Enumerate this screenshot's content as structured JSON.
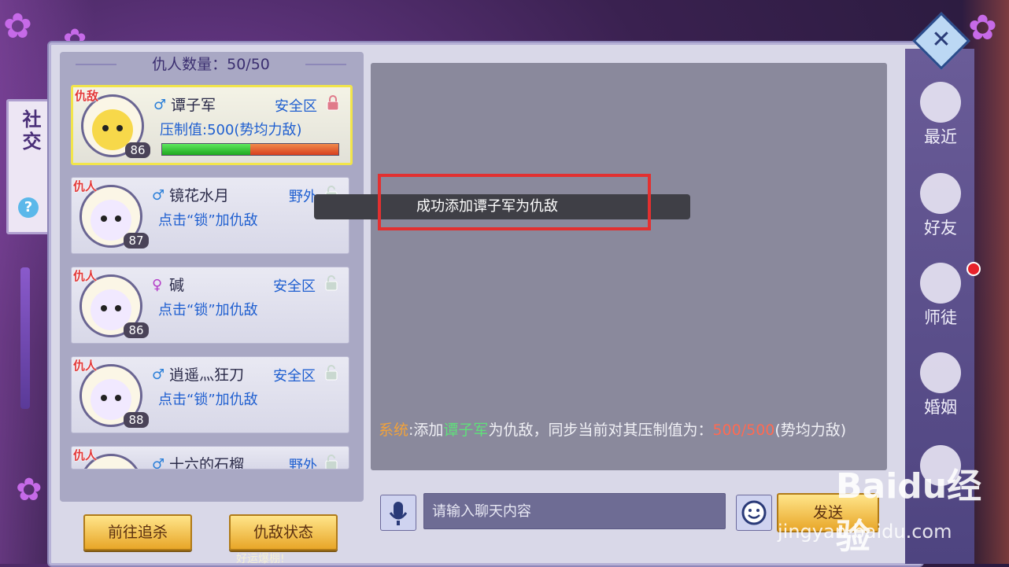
{
  "header": {
    "count_label": "仇人数量：50/50"
  },
  "sidebar_left": {
    "title": "社交",
    "help": "?"
  },
  "enemies": [
    {
      "tag": "仇敌",
      "name": "谭子军",
      "gender": "♂",
      "gender_color": "#2b7fd8",
      "zone": "安全区",
      "line": "压制值:500(势均力敌)",
      "level": "86",
      "has_bar": true,
      "selected": true
    },
    {
      "tag": "仇人",
      "name": "镜花水月",
      "gender": "♂",
      "gender_color": "#2b7fd8",
      "zone": "野外",
      "line": "点击“锁”加仇敌",
      "level": "87",
      "has_bar": false,
      "selected": false
    },
    {
      "tag": "仇人",
      "name": "碱",
      "gender": "♀",
      "gender_color": "#b43ec8",
      "zone": "安全区",
      "line": "点击“锁”加仇敌",
      "level": "86",
      "has_bar": false,
      "selected": false
    },
    {
      "tag": "仇人",
      "name": "逍遥灬狂刀",
      "gender": "♂",
      "gender_color": "#2b7fd8",
      "zone": "安全区",
      "line": "点击“锁”加仇敌",
      "level": "88",
      "has_bar": false,
      "selected": false
    },
    {
      "tag": "仇人",
      "name": "十六的石榴",
      "gender": "♂",
      "gender_color": "#2b7fd8",
      "zone": "野外",
      "line": "",
      "level": "",
      "has_bar": false,
      "selected": false
    }
  ],
  "buttons": {
    "chase": "前往追杀",
    "status": "仇敌状态"
  },
  "toast": "成功添加谭子军为仇敌",
  "system_message": {
    "prefix": "系统",
    "part1": ":添加",
    "name": "谭子军",
    "part2": "为仇敌，同步当前对其压制值为：",
    "value": "500/500",
    "part3": "(势均力敌)"
  },
  "chat_input": {
    "placeholder": "请输入聊天内容",
    "send": "发送"
  },
  "nav": [
    {
      "label": "最近",
      "icon": "chat-bubble-icon"
    },
    {
      "label": "好友",
      "icon": "friend-icon"
    },
    {
      "label": "师徒",
      "icon": "master-apprentice-icon"
    },
    {
      "label": "婚姻",
      "icon": "double-happiness-icon"
    },
    {
      "label": "",
      "icon": "axe-icon"
    }
  ],
  "close_symbol": "✕",
  "watermark": {
    "brand": "Baidu经验",
    "url": "jingyan.baidu.com"
  },
  "bottom_text": "好运爆棚!"
}
